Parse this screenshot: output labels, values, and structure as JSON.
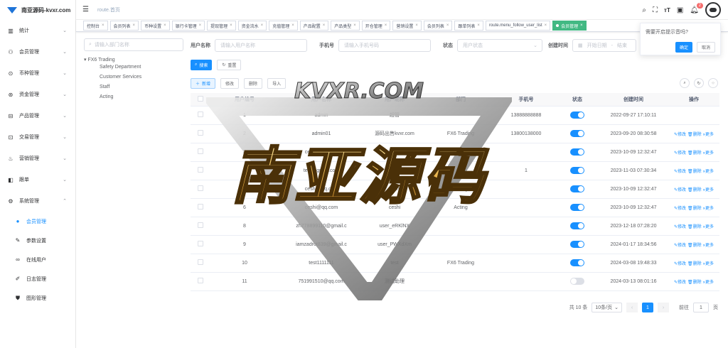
{
  "app": {
    "logo_text": "南亚源码-kvxr.com"
  },
  "sidebar": {
    "items": [
      {
        "icon": "chart-icon",
        "glyph": "▥",
        "label": "统计"
      },
      {
        "icon": "users-icon",
        "glyph": "⚇",
        "label": "会员管理"
      },
      {
        "icon": "currency-icon",
        "glyph": "⊙",
        "label": "币种管理"
      },
      {
        "icon": "fund-icon",
        "glyph": "⊛",
        "label": "资金管理"
      },
      {
        "icon": "product-icon",
        "glyph": "⊟",
        "label": "产品管理"
      },
      {
        "icon": "trade-icon",
        "glyph": "⊡",
        "label": "交易管理"
      },
      {
        "icon": "marketing-icon",
        "glyph": "♨",
        "label": "营销管理"
      },
      {
        "icon": "order-icon",
        "glyph": "◧",
        "label": "跟单"
      },
      {
        "icon": "system-icon",
        "glyph": "⚙",
        "label": "系统管理"
      }
    ],
    "sub_items": [
      {
        "icon": "user-icon",
        "glyph": "●",
        "label": "会员管理"
      },
      {
        "icon": "edit-icon",
        "glyph": "✎",
        "label": "参数设置"
      },
      {
        "icon": "online-icon",
        "glyph": "∞",
        "label": "在线用户"
      },
      {
        "icon": "log-icon",
        "glyph": "✐",
        "label": "日志管理"
      },
      {
        "icon": "shirt-icon",
        "glyph": "⛊",
        "label": "图形管理"
      }
    ]
  },
  "header": {
    "breadcrumb": "route.首页",
    "notification_count": "2"
  },
  "tags": [
    {
      "label": "控制台"
    },
    {
      "label": "会员列表"
    },
    {
      "label": "币种设置"
    },
    {
      "label": "银行卡管理"
    },
    {
      "label": "提现管理"
    },
    {
      "label": "资金流水"
    },
    {
      "label": "充值管理"
    },
    {
      "label": "产品配置"
    },
    {
      "label": "产品类型"
    },
    {
      "label": "开仓管理"
    },
    {
      "label": "营销设置"
    },
    {
      "label": "会员列表"
    },
    {
      "label": "跟单列表"
    },
    {
      "label": "route.menu_follow_user_list"
    },
    {
      "label": "会员管理"
    }
  ],
  "tree": {
    "search_placeholder": "请输入部门名称",
    "root": "FX6 Trading",
    "children": [
      "Safety Department",
      "Customer Services",
      "Staff",
      "Acting"
    ]
  },
  "form": {
    "username_label": "用户名称",
    "username_placeholder": "请输入用户名称",
    "phone_label": "手机号",
    "phone_placeholder": "请输入手机号码",
    "status_label": "状态",
    "status_placeholder": "用户状态",
    "created_label": "创建时间",
    "start_placeholder": "开始日期",
    "dash": "-",
    "end_placeholder": "结束"
  },
  "buttons": {
    "search": "搜索",
    "reset": "重置",
    "add": "新增",
    "edit": "修改",
    "delete": "删除",
    "import": "导入"
  },
  "table": {
    "headers": {
      "id": "用户编号",
      "username": "用户名称",
      "nickname": "用户昵称",
      "dept": "部门",
      "phone": "手机号",
      "status": "状态",
      "created": "创建时间",
      "ops": "操作"
    },
    "ops": {
      "edit": "修改",
      "delete": "删除",
      "more": "更多"
    },
    "rows": [
      {
        "id": "1",
        "username": "admin",
        "nickname": "超管",
        "dept": "",
        "phone": "13888888888",
        "status": "on",
        "created": "2022-09-27 17:10:11",
        "ops": false
      },
      {
        "id": "2",
        "username": "admin01",
        "nickname": "源码出售kvxr.com",
        "dept": "FX6 Trading",
        "phone": "13800138000",
        "status": "on",
        "created": "2023-09-20 08:30:58",
        "ops": true
      },
      {
        "id": "3",
        "username": "ceshi@qq.com",
        "nickname": "ceshi",
        "dept": "Acting",
        "phone": "",
        "status": "on",
        "created": "2023-10-09 12:32:47",
        "ops": true
      },
      {
        "id": "4",
        "username": "test@gmail.com",
        "nickname": "test",
        "dept": "",
        "phone": "1",
        "status": "on",
        "created": "2023-11-03 07:30:34",
        "ops": true
      },
      {
        "id": "5",
        "username": "ceshi@qq.com",
        "nickname": "ceshi",
        "dept": "Acting",
        "phone": "",
        "status": "on",
        "created": "2023-10-09 12:32:47",
        "ops": true
      },
      {
        "id": "6",
        "username": "ceshi@qq.com",
        "nickname": "ceshi",
        "dept": "Acting",
        "phone": "",
        "status": "on",
        "created": "2023-10-09 12:32:47",
        "ops": true
      },
      {
        "id": "8",
        "username": "zh778899110@gmail.c",
        "nickname": "user_eRKlNX",
        "dept": "",
        "phone": "",
        "status": "on",
        "created": "2023-12-18 07:28:20",
        "ops": true
      },
      {
        "id": "9",
        "username": "iamzadrot839@gmail.c",
        "nickname": "user_PWXdXm",
        "dept": "",
        "phone": "",
        "status": "on",
        "created": "2024-01-17 18:34:56",
        "ops": true
      },
      {
        "id": "10",
        "username": "test1111111",
        "nickname": "test",
        "dept": "FX6 Trading",
        "phone": "",
        "status": "on",
        "created": "2024-03-08 19:48:33",
        "ops": true
      },
      {
        "id": "11",
        "username": "751991510@qq.com",
        "nickname": "测试助理",
        "dept": "",
        "phone": "",
        "status": "off",
        "created": "2024-03-13 08:01:16",
        "ops": true
      }
    ]
  },
  "pagination": {
    "total": "共 10 条",
    "page_size": "10条/页",
    "current": "1",
    "goto_label": "前往",
    "goto_value": "1",
    "page_unit": "页"
  },
  "popover": {
    "message": "需要开启提示音吗?",
    "confirm": "确定",
    "cancel": "取消"
  },
  "watermark": {
    "top_text": "KVXR.COM",
    "main_text": "南亚源码"
  }
}
